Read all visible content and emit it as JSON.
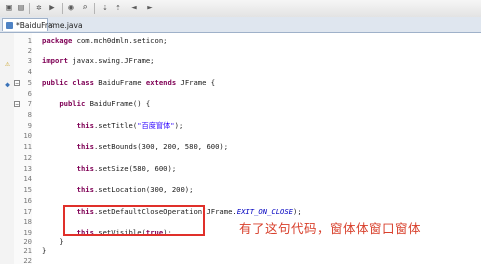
{
  "tab": {
    "label": "*BaiduFrame.java"
  },
  "toolbar": {
    "icons": [
      "save-icon",
      "print-icon",
      "debug-icon",
      "run-icon",
      "new-class-icon",
      "search-icon",
      "next-annotation-icon",
      "back-icon",
      "forward-icon"
    ]
  },
  "code": [
    {
      "n": "1",
      "text": "package com.mch0dmln.seticon;"
    },
    {
      "n": "2",
      "text": ""
    },
    {
      "n": "3",
      "text": "import javax.swing.JFrame;"
    },
    {
      "n": "4",
      "text": ""
    },
    {
      "n": "5",
      "text": "public class BaiduFrame extends JFrame {"
    },
    {
      "n": "6",
      "text": ""
    },
    {
      "n": "7",
      "text": "    public BaiduFrame() {"
    },
    {
      "n": "8",
      "text": ""
    },
    {
      "n": "9",
      "text": "        this.setTitle(\"百度窗体\");"
    },
    {
      "n": "10",
      "text": ""
    },
    {
      "n": "11",
      "text": "        this.setBounds(300, 200, 580, 600);"
    },
    {
      "n": "12",
      "text": ""
    },
    {
      "n": "13",
      "text": "        this.setSize(580, 600);"
    },
    {
      "n": "14",
      "text": ""
    },
    {
      "n": "15",
      "text": "        this.setLocation(300, 200);"
    },
    {
      "n": "16",
      "text": ""
    },
    {
      "n": "17",
      "text": "        this.setDefaultCloseOperation(JFrame.EXIT_ON_CLOSE);"
    },
    {
      "n": "18",
      "text": ""
    },
    {
      "n": "19",
      "text": "        this.setVisible(true);"
    },
    {
      "n": "20",
      "text": "    }"
    },
    {
      "n": "21",
      "text": "}"
    },
    {
      "n": "22",
      "text": ""
    }
  ],
  "annotation": {
    "text": "有了这句代码，窗体体窗口窗体"
  },
  "colors": {
    "highlight": "#e0302a",
    "annotation": "#d8402c"
  }
}
